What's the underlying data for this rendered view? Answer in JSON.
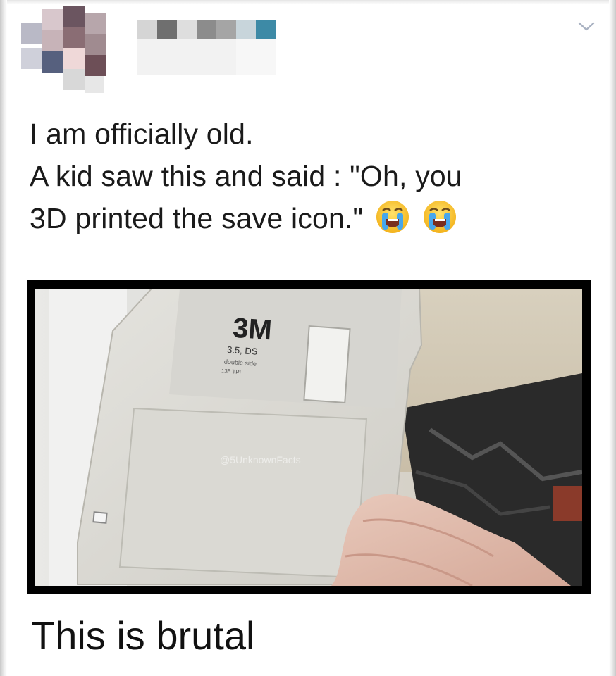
{
  "post": {
    "text_lines": [
      "I am officially old.",
      "A kid saw this and said : \"Oh, you",
      "3D printed the save icon.\""
    ],
    "emojis": [
      "loudly-crying-face-icon",
      "loudly-crying-face-icon"
    ],
    "menu_icon": "chevron-down-icon"
  },
  "photo": {
    "brand": "3M",
    "label_line1": "3.5, DS",
    "label_line2": "double side",
    "label_line3": "135 TPI",
    "watermark": "@5UnknownFacts",
    "icon": "floppy-disk-icon"
  },
  "caption": {
    "text": "This is brutal"
  },
  "colors": {
    "text": "#1a1a1a",
    "frame": "#000000",
    "disk": "#d9d8d3"
  }
}
